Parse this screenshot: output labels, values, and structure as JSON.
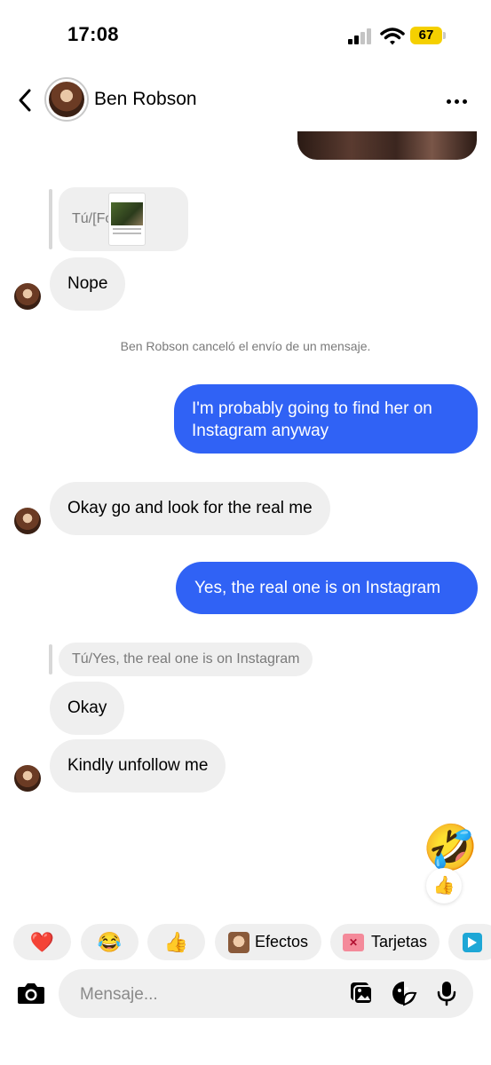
{
  "status_bar": {
    "time": "17:08",
    "battery": "67"
  },
  "header": {
    "contact_name": "Ben Robson"
  },
  "messages": {
    "reply1_label": "Tú/[Foto]",
    "nope": "Nope",
    "system_note": "Ben Robson canceló el envío de un mensaje.",
    "out1": "I'm probably going to find her on Instagram anyway",
    "in_okay_go": "Okay go and look for the real me",
    "out2": "Yes, the real one is on Instagram",
    "reply2_label": "Tú/Yes, the real one is on Instagram",
    "okay": "Okay",
    "kindly": "Kindly unfollow me"
  },
  "reactions": {
    "big": "🤣",
    "small": "👍"
  },
  "quick_row": {
    "heart": "❤️",
    "laugh": "😂",
    "thumbs": "👍",
    "efectos": "Efectos",
    "tarjetas": "Tarjetas"
  },
  "composer": {
    "placeholder": "Mensaje..."
  },
  "colors": {
    "accent_blue": "#3062f5",
    "bubble_gray": "#efefef",
    "battery_yellow": "#f5d000"
  }
}
